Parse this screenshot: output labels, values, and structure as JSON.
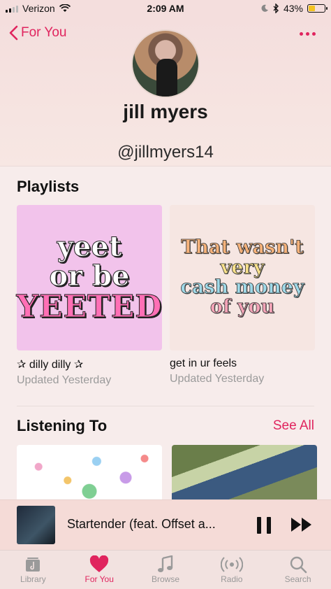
{
  "status_bar": {
    "carrier": "Verizon",
    "time": "2:09 AM",
    "battery": "43%",
    "battery_level": 0.43
  },
  "header": {
    "back_label": "For You",
    "name": "jill myers",
    "handle": "@jillmyers14"
  },
  "playlists": {
    "title": "Playlists",
    "items": [
      {
        "title": "✰ dilly dilly ✰",
        "updated": "Updated Yesterday",
        "cover_lines": [
          "yeet",
          "or be",
          "YEETED"
        ]
      },
      {
        "title": "get in ur feels",
        "updated": "Updated Yesterday",
        "cover_lines": [
          "That wasn't",
          "very",
          "cash money",
          "of you"
        ]
      }
    ]
  },
  "listening": {
    "title": "Listening To",
    "see_all": "See All"
  },
  "now_playing": {
    "title": "Startender (feat. Offset a..."
  },
  "tabs": [
    {
      "label": "Library",
      "icon": "library-icon",
      "active": false
    },
    {
      "label": "For You",
      "icon": "heart-icon",
      "active": true
    },
    {
      "label": "Browse",
      "icon": "music-note-icon",
      "active": false
    },
    {
      "label": "Radio",
      "icon": "radio-icon",
      "active": false
    },
    {
      "label": "Search",
      "icon": "search-icon",
      "active": false
    }
  ],
  "colors": {
    "accent": "#e0245e",
    "background": "#f7eceb"
  }
}
